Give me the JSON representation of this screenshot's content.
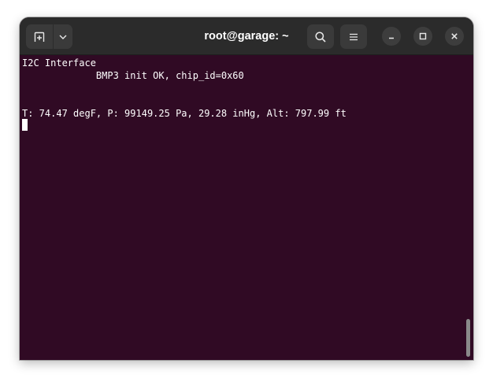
{
  "window": {
    "title": "root@garage: ~"
  },
  "toolbar": {
    "new_tab_icon": "new-tab-icon",
    "dropdown_icon": "chevron-down-icon",
    "search_icon": "search-icon",
    "menu_icon": "hamburger-menu-icon",
    "minimize_icon": "minimize-icon",
    "maximize_icon": "maximize-icon",
    "close_icon": "close-icon"
  },
  "terminal": {
    "lines": [
      "I2C Interface",
      "             BMP3 init OK, chip_id=0x60",
      "",
      "",
      "T: 74.47 degF, P: 99149.25 Pa, 29.28 inHg, Alt: 797.99 ft"
    ],
    "background": "#300a24",
    "foreground": "#ffffff"
  }
}
